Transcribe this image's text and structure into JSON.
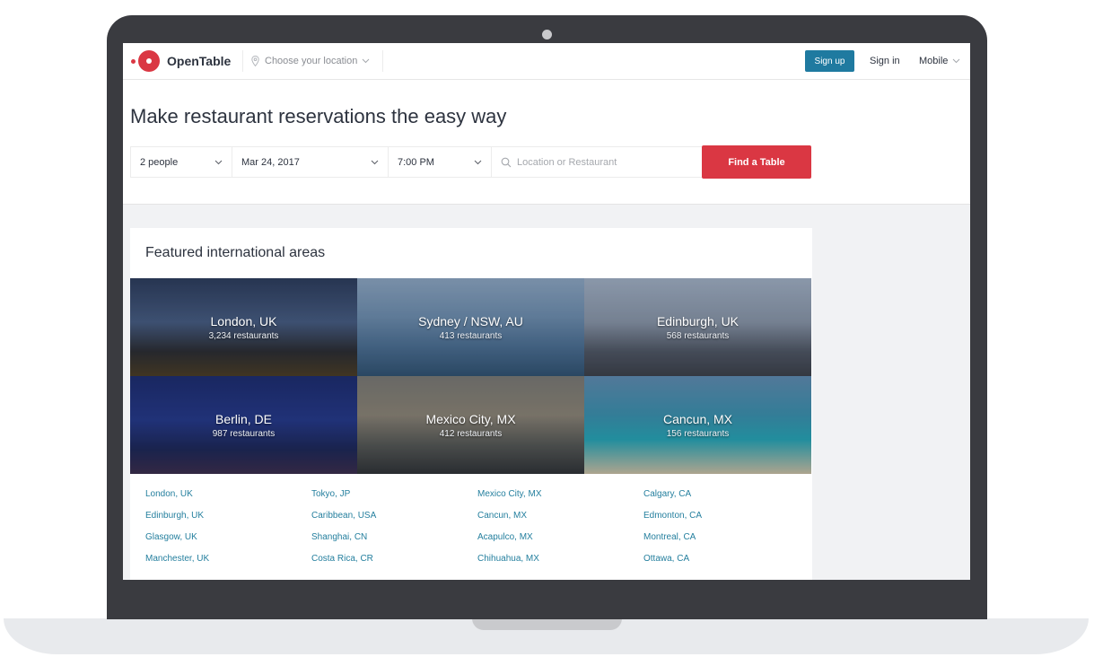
{
  "header": {
    "logo_text": "OpenTable",
    "location_placeholder": "Choose your location",
    "signup_label": "Sign up",
    "signin_label": "Sign in",
    "mobile_label": "Mobile"
  },
  "hero": {
    "title": "Make restaurant reservations the easy way",
    "party_size": "2 people",
    "date": "Mar 24, 2017",
    "time": "7:00 PM",
    "search_placeholder": "Location or Restaurant",
    "find_label": "Find a Table"
  },
  "featured": {
    "title": "Featured international areas",
    "tiles": [
      {
        "name": "London, UK",
        "count": "3,234 restaurants"
      },
      {
        "name": "Sydney / NSW, AU",
        "count": "413 restaurants"
      },
      {
        "name": "Edinburgh, UK",
        "count": "568 restaurants"
      },
      {
        "name": "Berlin, DE",
        "count": "987 restaurants"
      },
      {
        "name": "Mexico City, MX",
        "count": "412 restaurants"
      },
      {
        "name": "Cancun, MX",
        "count": "156 restaurants"
      }
    ],
    "links": [
      [
        "London, UK",
        "Edinburgh, UK",
        "Glasgow, UK",
        "Manchester, UK"
      ],
      [
        "Tokyo, JP",
        "Caribbean, USA",
        "Shanghai, CN",
        "Costa Rica, CR"
      ],
      [
        "Mexico City, MX",
        "Cancun, MX",
        "Acapulco, MX",
        "Chihuahua, MX"
      ],
      [
        "Calgary, CA",
        "Edmonton, CA",
        "Montreal, CA",
        "Ottawa, CA"
      ]
    ]
  },
  "colors": {
    "brand_red": "#da3743",
    "signup_blue": "#1f7aa0",
    "link_blue": "#247f9e"
  }
}
